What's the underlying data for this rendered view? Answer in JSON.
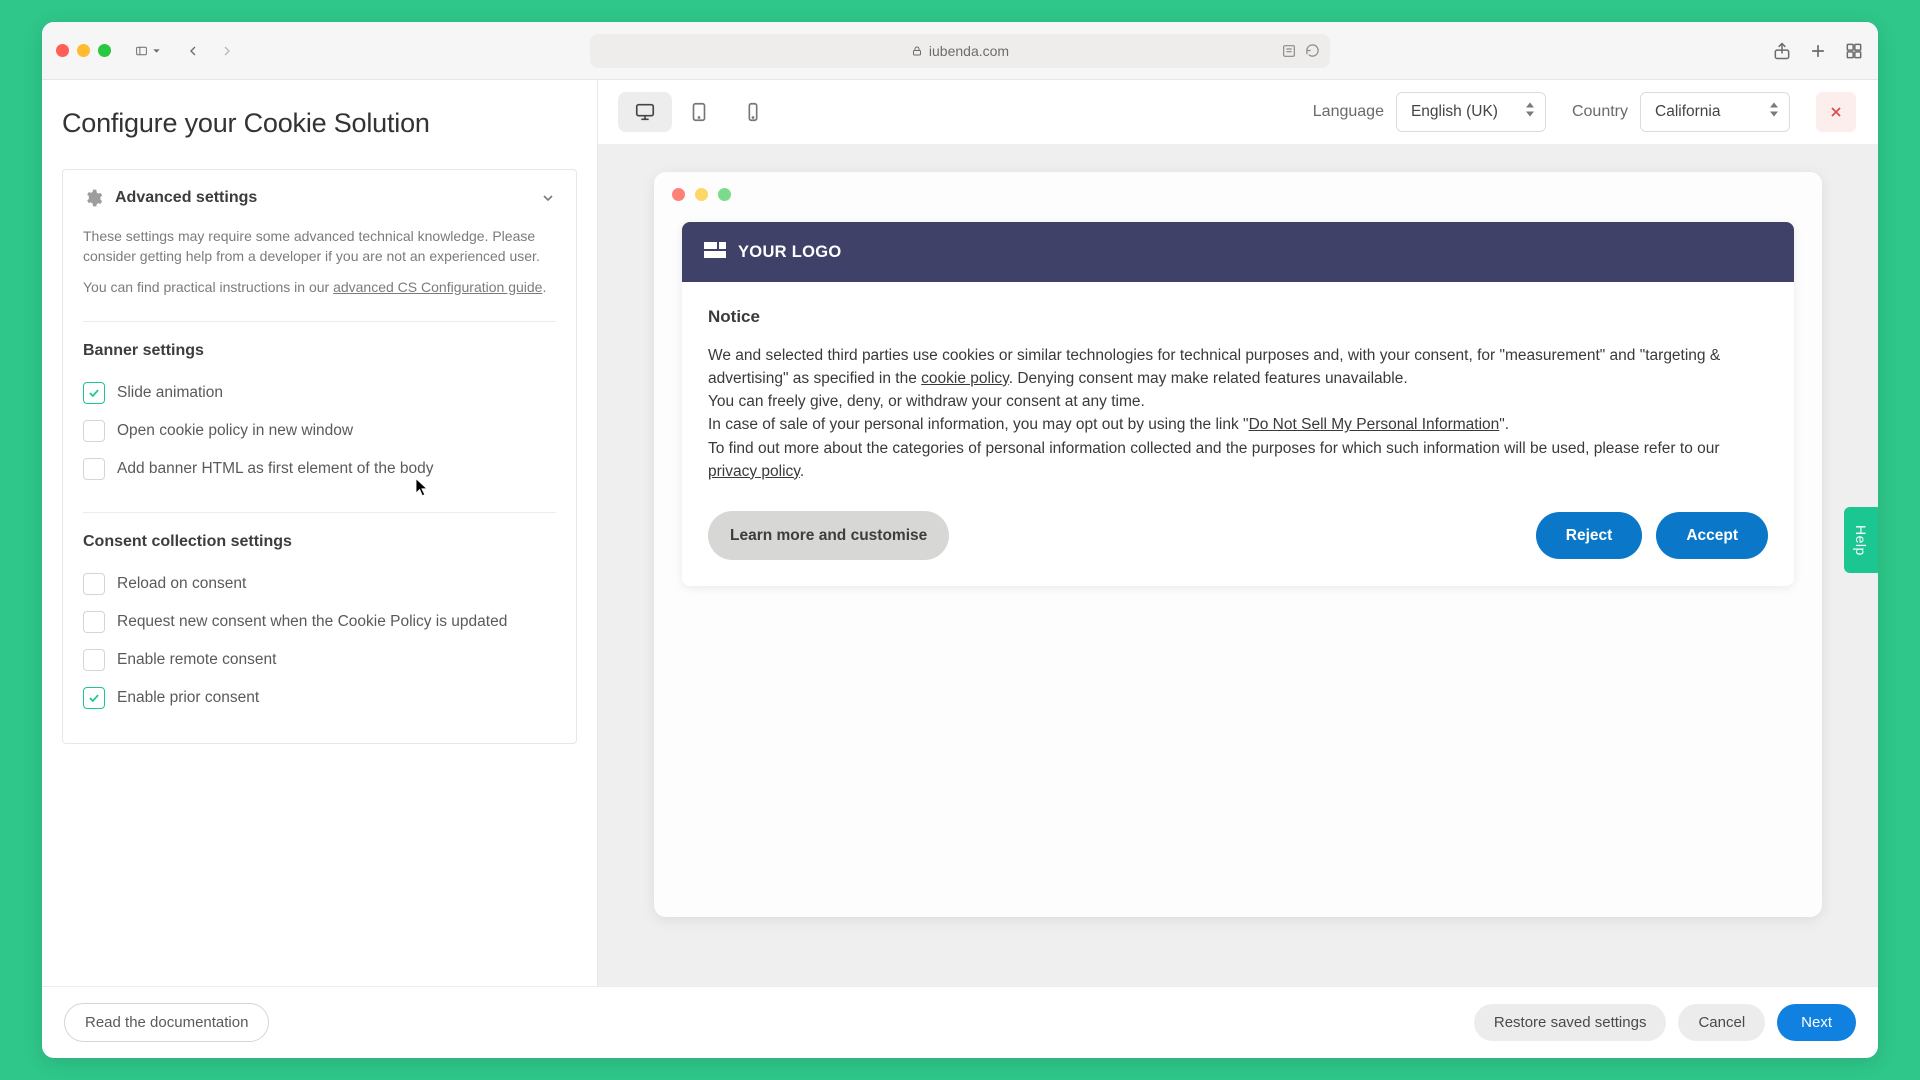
{
  "browser": {
    "url_host": "iubenda.com"
  },
  "page": {
    "title": "Configure your Cookie Solution",
    "language_label": "Language",
    "language_value": "English (UK)",
    "country_label": "Country",
    "country_value": "California",
    "help_tab": "Help"
  },
  "advanced": {
    "title": "Advanced settings",
    "desc1": "These settings may require some advanced technical knowledge. Please consider getting help from a developer if you are not an experienced user.",
    "desc2_pre": "You can find practical instructions in our ",
    "desc2_link": "advanced CS Configuration guide",
    "desc2_post": "."
  },
  "banner_settings": {
    "title": "Banner settings",
    "options": [
      {
        "label": "Slide animation",
        "checked": true
      },
      {
        "label": "Open cookie policy in new window",
        "checked": false
      },
      {
        "label": "Add banner HTML as first element of the body",
        "checked": false
      }
    ]
  },
  "consent_settings": {
    "title": "Consent collection settings",
    "options": [
      {
        "label": "Reload on consent",
        "checked": false
      },
      {
        "label": "Request new consent when the Cookie Policy is updated",
        "checked": false
      },
      {
        "label": "Enable remote consent",
        "checked": false
      },
      {
        "label": "Enable prior consent",
        "checked": true
      }
    ]
  },
  "preview": {
    "logo_text": "YOUR LOGO",
    "notice_title": "Notice",
    "p1a": "We and selected third parties use cookies or similar technologies for technical purposes and, with your consent, for \"measurement\" and \"targeting & advertising\" as specified in the ",
    "p1_link": "cookie policy",
    "p1b": ". Denying consent may make related features unavailable.",
    "p2": "You can freely give, deny, or withdraw your consent at any time.",
    "p3a": "In case of sale of your personal information, you may opt out by using the link \"",
    "p3_link": "Do Not Sell My Personal Information",
    "p3b": "\".",
    "p4a": "To find out more about the categories of personal information collected and the purposes for which such information will be used, please refer to our ",
    "p4_link": "privacy policy",
    "p4b": ".",
    "learn": "Learn more and customise",
    "reject": "Reject",
    "accept": "Accept"
  },
  "footer": {
    "docs": "Read the documentation",
    "restore": "Restore saved settings",
    "cancel": "Cancel",
    "next": "Next"
  }
}
